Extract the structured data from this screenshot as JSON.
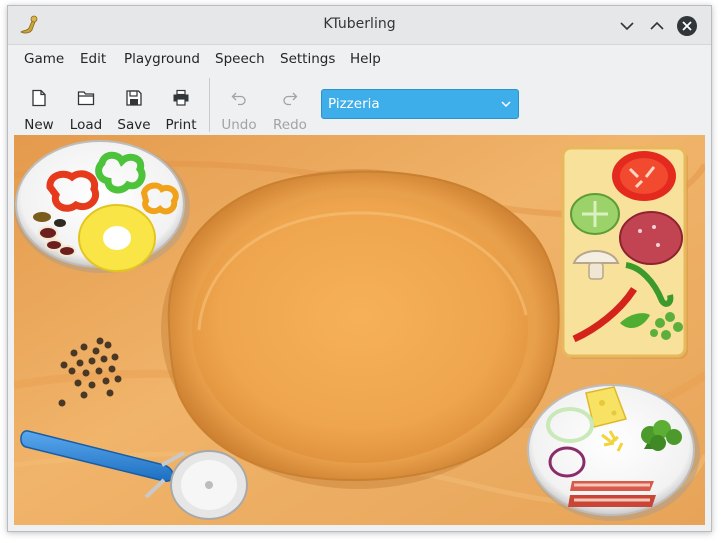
{
  "window": {
    "title": "KTuberling"
  },
  "menubar": {
    "items": [
      "Game",
      "Edit",
      "Playground",
      "Speech",
      "Settings",
      "Help"
    ]
  },
  "toolbar": {
    "new_label": "New",
    "load_label": "Load",
    "save_label": "Save",
    "print_label": "Print",
    "undo_label": "Undo",
    "redo_label": "Redo",
    "playground_select": "Pizzeria"
  },
  "colors": {
    "accent": "#3daee9",
    "table": "#e9a85a",
    "crust": "#e08f35"
  },
  "icons": {
    "app": "ktuberling-icon",
    "minimize": "chevron-down-icon",
    "maximize": "chevron-up-icon",
    "close": "close-icon"
  }
}
